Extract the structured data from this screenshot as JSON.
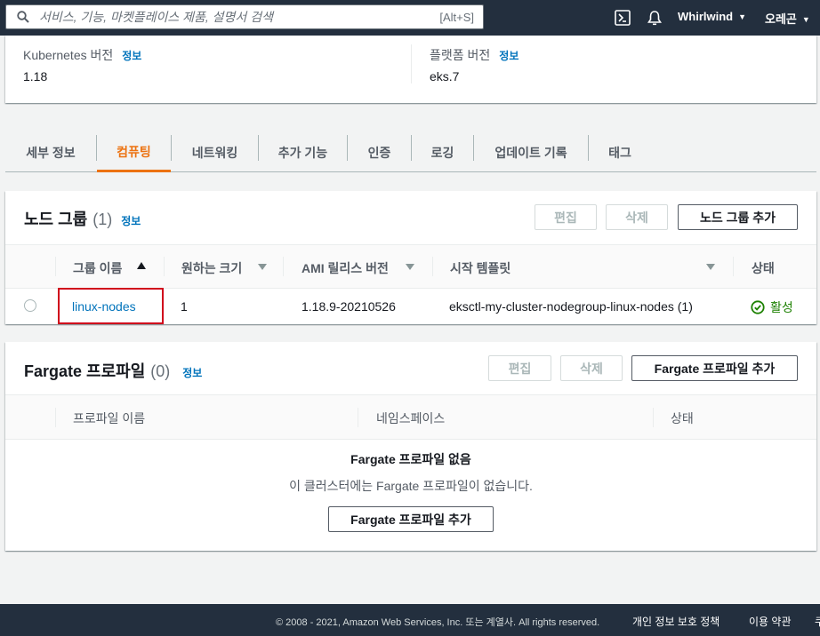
{
  "topbar": {
    "search_placeholder": "서비스, 기능, 마켓플레이스 제품, 설명서 검색",
    "search_shortcut": "[Alt+S]",
    "account": "Whirlwind",
    "region": "오레곤"
  },
  "cluster_info": {
    "k8s_label": "Kubernetes 버전",
    "k8s_value": "1.18",
    "platform_label": "플랫폼 버전",
    "platform_value": "eks.7",
    "info_link": "정보"
  },
  "tabs": [
    {
      "label": "세부 정보"
    },
    {
      "label": "컴퓨팅",
      "active": true
    },
    {
      "label": "네트워킹"
    },
    {
      "label": "추가 기능"
    },
    {
      "label": "인증"
    },
    {
      "label": "로깅"
    },
    {
      "label": "업데이트 기록"
    },
    {
      "label": "태그"
    }
  ],
  "node_groups": {
    "title": "노드 그룹",
    "count": "(1)",
    "info": "정보",
    "edit": "편집",
    "delete": "삭제",
    "add": "노드 그룹 추가",
    "columns": [
      "그룹 이름",
      "원하는 크기",
      "AMI 릴리스 버전",
      "시작 템플릿",
      "상태"
    ],
    "rows": [
      {
        "name": "linux-nodes",
        "desired_size": "1",
        "ami_version": "1.18.9-20210526",
        "launch_template": "eksctl-my-cluster-nodegroup-linux-nodes (1)",
        "status": "활성"
      }
    ]
  },
  "fargate": {
    "title": "Fargate 프로파일",
    "count": "(0)",
    "info": "정보",
    "edit": "편집",
    "delete": "삭제",
    "add": "Fargate 프로파일 추가",
    "columns": [
      "프로파일 이름",
      "네임스페이스",
      "상태"
    ],
    "empty_title": "Fargate 프로파일 없음",
    "empty_text": "이 클러스터에는 Fargate 프로파일이 없습니다.",
    "empty_button": "Fargate 프로파일 추가"
  },
  "footer": {
    "copyright": "© 2008 - 2021, Amazon Web Services, Inc. 또는 계열사. All rights reserved.",
    "privacy": "개인 정보 보호 정책",
    "terms": "이용 약관",
    "cookie_partial": "쿠"
  },
  "colors": {
    "accent": "#ec7211",
    "link": "#0073bb",
    "success": "#1d8102",
    "topbar": "#232f3e",
    "highlight": "#d0021b"
  }
}
